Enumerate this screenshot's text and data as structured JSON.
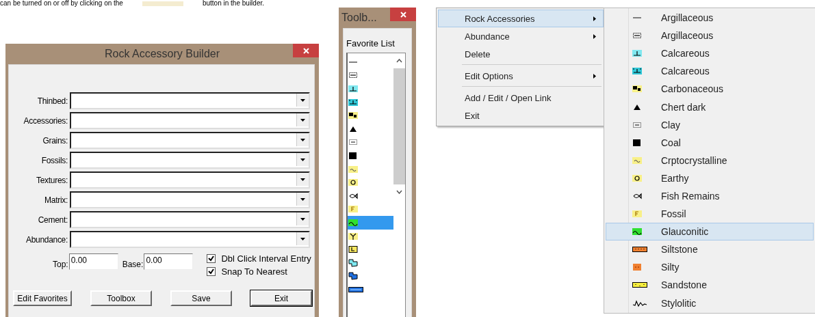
{
  "caption": {
    "before": "can be turned on or off by clicking on the",
    "after": "button in the builder."
  },
  "builder": {
    "title": "Rock Accessory Builder",
    "fields": [
      {
        "label": "Thinbed:"
      },
      {
        "label": "Accessories:"
      },
      {
        "label": "Grains:"
      },
      {
        "label": "Fossils:"
      },
      {
        "label": "Textures:"
      },
      {
        "label": "Matrix:"
      },
      {
        "label": "Cement:"
      },
      {
        "label": "Abundance:"
      }
    ],
    "top": {
      "label": "Top:",
      "value": "0.00"
    },
    "base": {
      "label": "Base:",
      "value": "0.00"
    },
    "checkboxes": [
      {
        "label": "Dbl Click Interval Entry",
        "checked": true
      },
      {
        "label": "Snap To Nearest",
        "checked": true
      }
    ],
    "buttons": [
      {
        "label": "Edit Favorites",
        "default": false
      },
      {
        "label": "Toolbox",
        "default": false
      },
      {
        "label": "Save",
        "default": false
      },
      {
        "label": "Exit",
        "default": true
      }
    ]
  },
  "toolbox": {
    "title": "Toolb...",
    "heading": "Favorite List",
    "items": [
      {
        "kind": "dash",
        "selected": false
      },
      {
        "kind": "hatch",
        "selected": false
      },
      {
        "kind": "calc",
        "selected": false
      },
      {
        "kind": "calc2",
        "selected": false
      },
      {
        "kind": "carbon",
        "selected": false
      },
      {
        "kind": "chert",
        "selected": false
      },
      {
        "kind": "clay",
        "selected": false
      },
      {
        "kind": "coal",
        "selected": false
      },
      {
        "kind": "crypto",
        "selected": false
      },
      {
        "kind": "earthy",
        "selected": false
      },
      {
        "kind": "fish",
        "selected": false
      },
      {
        "kind": "fossil",
        "selected": false
      },
      {
        "kind": "glauc",
        "selected": true
      },
      {
        "kind": "fork",
        "selected": false
      },
      {
        "kind": "lbox",
        "selected": false
      },
      {
        "kind": "cyanshape",
        "selected": false
      },
      {
        "kind": "blueshape",
        "selected": false
      },
      {
        "kind": "bluebar",
        "selected": false
      }
    ]
  },
  "context_menu": {
    "items": [
      {
        "label": "Rock Accessories",
        "submenu": true,
        "highlighted": true,
        "separator_before": false
      },
      {
        "label": "Abundance",
        "submenu": true,
        "highlighted": false,
        "separator_before": false
      },
      {
        "label": "Delete",
        "submenu": false,
        "highlighted": false,
        "separator_before": false
      },
      {
        "label": "Edit Options",
        "submenu": true,
        "highlighted": false,
        "separator_before": true
      },
      {
        "label": "Add / Edit / Open Link",
        "submenu": false,
        "highlighted": false,
        "separator_before": true
      },
      {
        "label": "Exit",
        "submenu": false,
        "highlighted": false,
        "separator_before": false
      }
    ]
  },
  "submenu": {
    "items": [
      {
        "label": "Argillaceous",
        "kind": "dash",
        "highlighted": false
      },
      {
        "label": "Argillaceous",
        "kind": "hatch",
        "highlighted": false
      },
      {
        "label": "Calcareous",
        "kind": "calc",
        "highlighted": false
      },
      {
        "label": "Calcareous",
        "kind": "calc2",
        "highlighted": false
      },
      {
        "label": "Carbonaceous",
        "kind": "carbon",
        "highlighted": false
      },
      {
        "label": "Chert dark",
        "kind": "chert",
        "highlighted": false
      },
      {
        "label": "Clay",
        "kind": "clay",
        "highlighted": false
      },
      {
        "label": "Coal",
        "kind": "coal",
        "highlighted": false
      },
      {
        "label": "Crptocrystalline",
        "kind": "crypto",
        "highlighted": false
      },
      {
        "label": "Earthy",
        "kind": "earthy",
        "highlighted": false
      },
      {
        "label": "Fish Remains",
        "kind": "fish",
        "highlighted": false
      },
      {
        "label": "Fossil",
        "kind": "fossil",
        "highlighted": false
      },
      {
        "label": "Glauconitic",
        "kind": "glauc",
        "highlighted": true
      },
      {
        "label": "Siltstone",
        "kind": "siltstone",
        "highlighted": false
      },
      {
        "label": "Silty",
        "kind": "silty",
        "highlighted": false
      },
      {
        "label": "Sandstone",
        "kind": "sandstone",
        "highlighted": false
      },
      {
        "label": "Stylolitic",
        "kind": "stylo",
        "highlighted": false
      }
    ]
  }
}
